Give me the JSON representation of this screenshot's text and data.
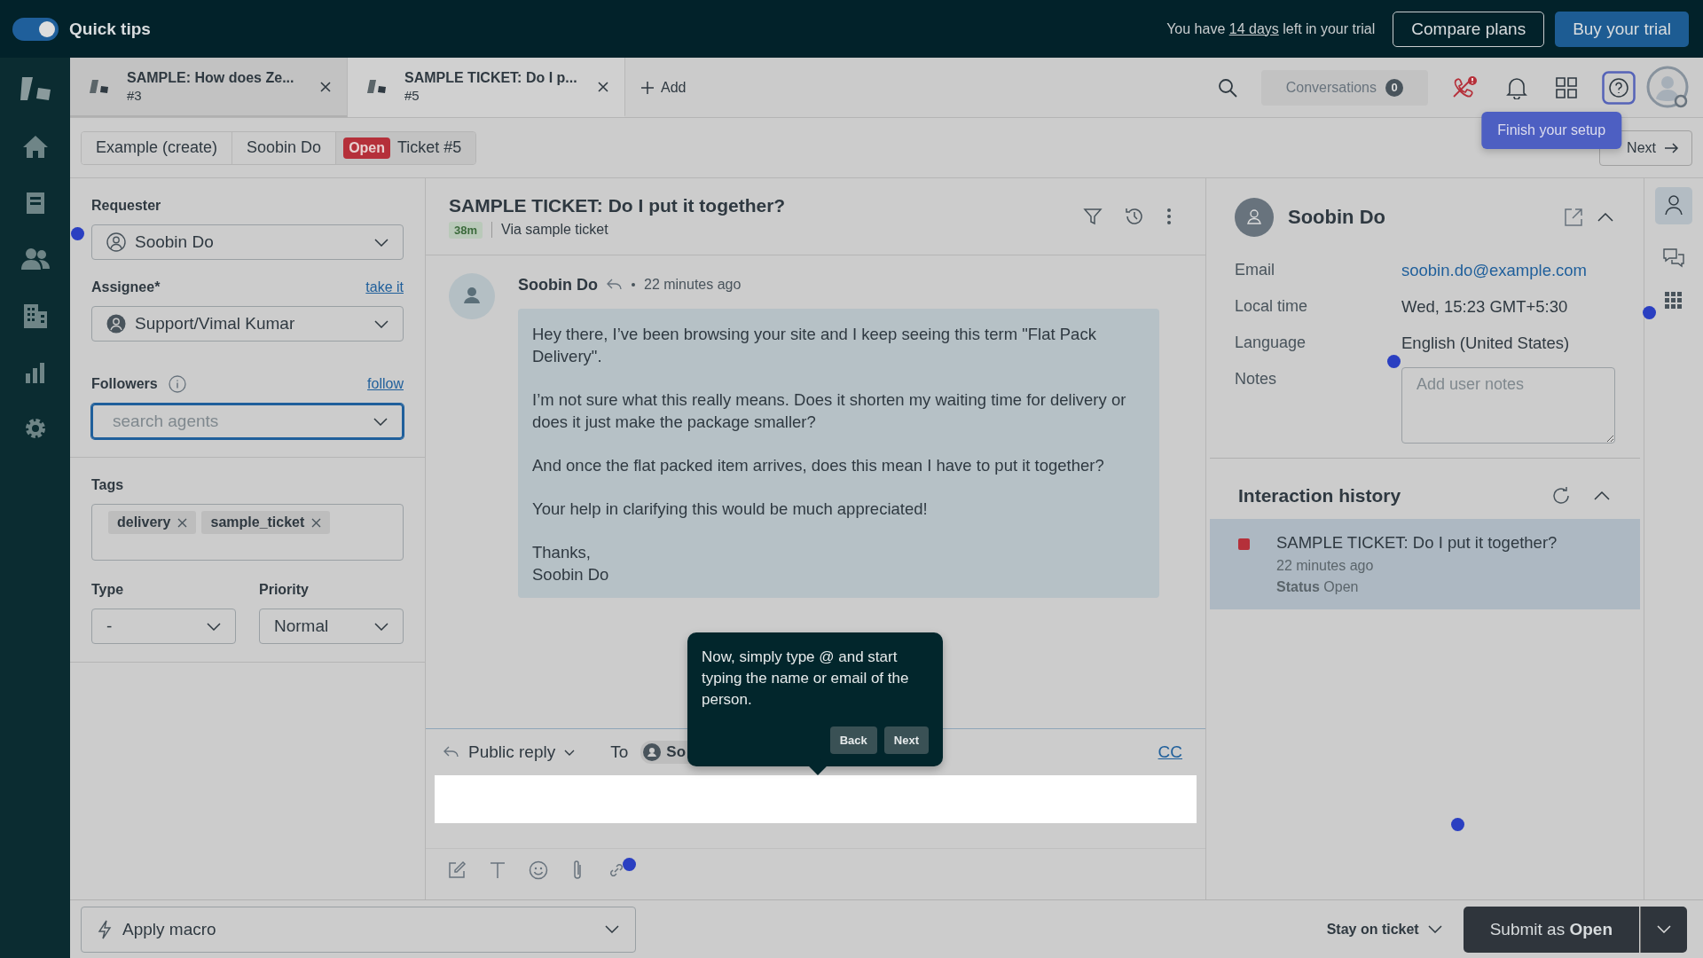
{
  "topbar": {
    "quick_tips": {
      "label": "Quick tips",
      "on": true
    },
    "trial": {
      "before": "You have",
      "link": "14 days",
      "after": "left in your trial"
    },
    "compare_button": "Compare plans",
    "buy_button": "Buy your trial"
  },
  "tabs": [
    {
      "title": "SAMPLE: How does Ze...",
      "number": "#3",
      "selected": false
    },
    {
      "title": "SAMPLE TICKET: Do I p...",
      "number": "#5",
      "selected": true
    }
  ],
  "add_tab": "Add",
  "toolbar": {
    "conversations": "Conversations",
    "conversations_count": "0",
    "setup_tip": "Finish your setup"
  },
  "breadcrumbs": [
    {
      "label": "Example (create)",
      "kind": "plain",
      "selected": false
    },
    {
      "label": "Soobin Do",
      "kind": "plain",
      "selected": false
    },
    {
      "label": "Ticket #5",
      "status": "Open",
      "kind": "status",
      "selected": true
    }
  ],
  "next_button": "Next",
  "properties": {
    "requester": {
      "label": "Requester",
      "value": "Soobin Do"
    },
    "assignee": {
      "label": "Assignee*",
      "link": "take it",
      "value": "Support/Vimal Kumar"
    },
    "followers": {
      "label": "Followers",
      "link": "follow",
      "placeholder": "search agents"
    },
    "tags": {
      "label": "Tags",
      "items": [
        "delivery",
        "sample_ticket"
      ]
    },
    "type": {
      "label": "Type",
      "value": "-"
    },
    "priority": {
      "label": "Priority",
      "value": "Normal"
    }
  },
  "ticket": {
    "title": "SAMPLE TICKET: Do I put it together?",
    "age": "38m",
    "channel": "Via sample ticket"
  },
  "message": {
    "author": "Soobin Do",
    "time": "22 minutes ago",
    "paragraphs": [
      [
        "Hey there, I’ve been browsing your site and I keep seeing this term \"Flat Pack Delivery\"."
      ],
      [
        "I’m not sure what this really means. Does it shorten my waiting time for delivery or does it just make the package smaller?"
      ],
      [
        "And once the flat packed item arrives, does this mean I have to put it together?"
      ],
      [
        "Your help in clarifying this would be much appreciated!"
      ],
      [
        "Thanks,",
        "Soobin Do"
      ]
    ]
  },
  "reply": {
    "mode": "Public reply",
    "to": "To",
    "recipient": "So",
    "cc": "CC"
  },
  "tour": {
    "text": "Now, simply type @ and start typing the name or email of the person.",
    "back": "Back",
    "next": "Next"
  },
  "user": {
    "name": "Soobin Do",
    "fields": [
      {
        "label": "Email",
        "value": "soobin.do@example.com",
        "kind": "link"
      },
      {
        "label": "Local time",
        "value": "Wed, 15:23 GMT+5:30",
        "kind": "text"
      },
      {
        "label": "Language",
        "value": "English (United States)",
        "kind": "text"
      },
      {
        "label": "Notes",
        "placeholder": "Add user notes",
        "kind": "notes"
      }
    ]
  },
  "history": {
    "title": "Interaction history",
    "items": [
      {
        "title": "SAMPLE TICKET: Do I put it together?",
        "time": "22 minutes ago",
        "status_label": "Status",
        "status": "Open",
        "color": "#b5303a",
        "selected": true
      }
    ]
  },
  "footer": {
    "macro": "Apply macro",
    "stay": "Stay on ticket",
    "submit": "Submit as **Open**"
  }
}
